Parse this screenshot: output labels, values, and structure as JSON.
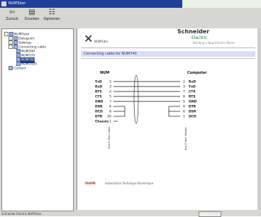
{
  "window": {
    "title": "NUMTutor"
  },
  "toolbar": {
    "buttons": [
      {
        "label": "Zurück",
        "icon": "back-arrow-icon"
      },
      {
        "label": "Drucken",
        "icon": "print-icon"
      },
      {
        "label": "Optionen",
        "icon": "options-icon"
      }
    ]
  },
  "tree": {
    "items": [
      {
        "label": "NUMTutor",
        "level": 0,
        "selected": false
      },
      {
        "label": "Datagram",
        "level": 1,
        "selected": false
      },
      {
        "label": "Settings",
        "level": 1,
        "selected": false
      },
      {
        "label": "Connecting cable",
        "level": 1,
        "selected": false
      },
      {
        "label": "NUM340",
        "level": 2,
        "selected": false
      },
      {
        "label": "NUM370",
        "level": 2,
        "selected": false
      },
      {
        "label": "NUM760",
        "level": 2,
        "selected": true
      },
      {
        "label": "NUM1020",
        "level": 2,
        "selected": false
      },
      {
        "label": "Contact",
        "level": 1,
        "selected": false
      }
    ]
  },
  "content": {
    "logo_left_mark": "✕",
    "logo_left_text": "NUMTutor",
    "logo_right_brand": "Schneider",
    "logo_right_sub": "Electric",
    "logo_right_tag": "Building a New Electric World",
    "heading": "Connecting cable for NUM740",
    "diagram": {
      "left_title": "NUM",
      "right_title": "Computer",
      "left_pins": [
        {
          "name": "TxD",
          "pin": "2"
        },
        {
          "name": "RxD",
          "pin": "3"
        },
        {
          "name": "RTS",
          "pin": "4"
        },
        {
          "name": "CTS",
          "pin": "5"
        },
        {
          "name": "GND",
          "pin": "7"
        },
        {
          "name": "DSR",
          "pin": "6"
        },
        {
          "name": "DCD",
          "pin": "8"
        },
        {
          "name": "DTR",
          "pin": "20"
        },
        {
          "name": "Chassis",
          "pin": "1"
        }
      ],
      "right_pins": [
        {
          "pin": "2",
          "name": "RxD"
        },
        {
          "pin": "3",
          "name": "TxD"
        },
        {
          "pin": "7",
          "name": "CTS"
        },
        {
          "pin": "8",
          "name": "RTS"
        },
        {
          "pin": "5",
          "name": "GND"
        },
        {
          "pin": "4",
          "name": "DTR"
        },
        {
          "pin": "6",
          "name": "DSR"
        },
        {
          "pin": "1",
          "name": "DCD"
        }
      ],
      "left_caption": "Sub-D 25pin male",
      "right_caption": "Sub-D 9pin female"
    },
    "footer_brand": "num",
    "footer_text": "Automation Technique Numérique"
  },
  "status": {
    "text": "Schneider Electric NUMTutor"
  },
  "colors": {
    "title_bar": "#1f3f98",
    "selection": "#1d3a91",
    "heading_bg": "#d8dff0",
    "heading_text": "#25338a",
    "brand_green": "#1d7a3a",
    "brand_red": "#c92e1e"
  }
}
